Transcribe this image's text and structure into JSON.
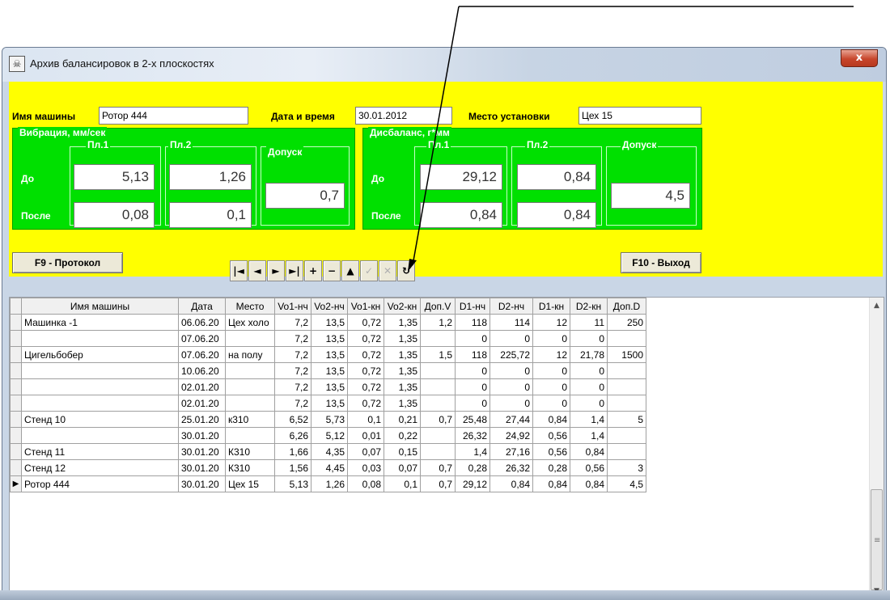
{
  "window": {
    "title": "Архив балансировок в 2-х плоскостях",
    "close_symbol": "x"
  },
  "header": {
    "machine_label": "Имя машины",
    "machine_value": "Ротор 444",
    "date_label": "Дата и время",
    "date_value": "30.01.2012",
    "place_label": "Место установки",
    "place_value": "Цех 15"
  },
  "vibration": {
    "title": "Вибрация, мм/сек",
    "p1": "Пл.1",
    "p2": "Пл.2",
    "tol": "Допуск",
    "before": "До",
    "after": "После",
    "before_p1": "5,13",
    "before_p2": "1,26",
    "after_p1": "0,08",
    "after_p2": "0,1",
    "tol_value": "0,7"
  },
  "imbalance": {
    "title": "Дисбаланс, г*мм",
    "p1": "Пл.1",
    "p2": "Пл.2",
    "tol": "Допуск",
    "before": "До",
    "after": "После",
    "before_p1": "29,12",
    "before_p2": "0,84",
    "after_p1": "0,84",
    "after_p2": "0,84",
    "tol_value": "4,5"
  },
  "buttons": {
    "protocol": "F9 - Протокол",
    "exit": "F10 - Выход"
  },
  "navigator": [
    {
      "icon": "first-record-icon",
      "glyph": "|◄",
      "enabled": true
    },
    {
      "icon": "prior-record-icon",
      "glyph": "◄",
      "enabled": true
    },
    {
      "icon": "next-record-icon",
      "glyph": "►",
      "enabled": true
    },
    {
      "icon": "last-record-icon",
      "glyph": "►|",
      "enabled": true
    },
    {
      "icon": "insert-record-icon",
      "glyph": "+",
      "enabled": true
    },
    {
      "icon": "delete-record-icon",
      "glyph": "−",
      "enabled": true
    },
    {
      "icon": "edit-record-icon",
      "glyph": "▲",
      "enabled": true
    },
    {
      "icon": "post-record-icon",
      "glyph": "✓",
      "enabled": false
    },
    {
      "icon": "cancel-record-icon",
      "glyph": "✕",
      "enabled": false
    },
    {
      "icon": "refresh-icon",
      "glyph": "↻",
      "enabled": true
    }
  ],
  "grid": {
    "columns": [
      "Имя машины",
      "Дата",
      "Место",
      "Vo1-нч",
      "Vo2-нч",
      "Vo1-кн",
      "Vo2-кн",
      "Доп.V",
      "D1-нч",
      "D2-нч",
      "D1-кн",
      "D2-кн",
      "Доп.D"
    ],
    "rows": [
      [
        "Машинка -1",
        "06.06.20",
        "Цех холо",
        "7,2",
        "13,5",
        "0,72",
        "1,35",
        "1,2",
        "118",
        "114",
        "12",
        "11",
        "250"
      ],
      [
        "",
        "07.06.20",
        "",
        "7,2",
        "13,5",
        "0,72",
        "1,35",
        "",
        "0",
        "0",
        "0",
        "0",
        ""
      ],
      [
        "Цигельбобер",
        "07.06.20",
        "на полу",
        "7,2",
        "13,5",
        "0,72",
        "1,35",
        "1,5",
        "118",
        "225,72",
        "12",
        "21,78",
        "1500"
      ],
      [
        "",
        "10.06.20",
        "",
        "7,2",
        "13,5",
        "0,72",
        "1,35",
        "",
        "0",
        "0",
        "0",
        "0",
        ""
      ],
      [
        "",
        "02.01.20",
        "",
        "7,2",
        "13,5",
        "0,72",
        "1,35",
        "",
        "0",
        "0",
        "0",
        "0",
        ""
      ],
      [
        "",
        "02.01.20",
        "",
        "7,2",
        "13,5",
        "0,72",
        "1,35",
        "",
        "0",
        "0",
        "0",
        "0",
        ""
      ],
      [
        "Стенд 10",
        "25.01.20",
        "к310",
        "6,52",
        "5,73",
        "0,1",
        "0,21",
        "0,7",
        "25,48",
        "27,44",
        "0,84",
        "1,4",
        "5"
      ],
      [
        "",
        "30.01.20",
        "",
        "6,26",
        "5,12",
        "0,01",
        "0,22",
        "",
        "26,32",
        "24,92",
        "0,56",
        "1,4",
        ""
      ],
      [
        "Стенд 11",
        "30.01.20",
        "К310",
        "1,66",
        "4,35",
        "0,07",
        "0,15",
        "",
        "1,4",
        "27,16",
        "0,56",
        "0,84",
        ""
      ],
      [
        "Стенд 12",
        "30.01.20",
        "К310",
        "1,56",
        "4,45",
        "0,03",
        "0,07",
        "0,7",
        "0,28",
        "26,32",
        "0,28",
        "0,56",
        "3"
      ],
      [
        "Ротор 444",
        "30.01.20",
        "Цех 15",
        "5,13",
        "1,26",
        "0,08",
        "0,1",
        "0,7",
        "29,12",
        "0,84",
        "0,84",
        "0,84",
        "4,5"
      ]
    ],
    "current_row": 10,
    "current_marker": "▶"
  },
  "scrollbar": {
    "up": "▲",
    "down": "▼",
    "grip": "≡"
  }
}
